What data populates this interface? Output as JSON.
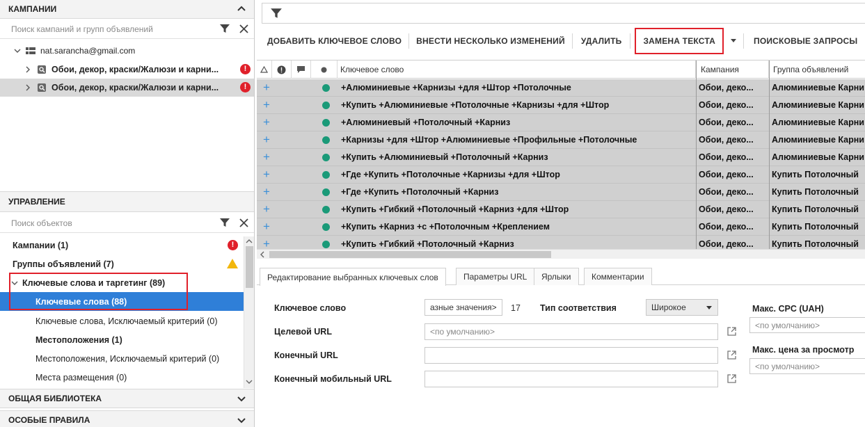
{
  "campaigns_panel": {
    "title": "КАМПАНИИ",
    "search_placeholder": "Поиск кампаний и групп объявлений",
    "account": "nat.sarancha@gmail.com",
    "items": [
      {
        "label": "Обои, декор, краски/Жалюзи и карни...",
        "badge": "!"
      },
      {
        "label": "Обои, декор, краски/Жалюзи и карни...",
        "badge": "!"
      }
    ]
  },
  "management_panel": {
    "title": "УПРАВЛЕНИЕ",
    "search_placeholder": "Поиск объектов",
    "items": [
      {
        "label": "Кампании (1)",
        "badge": "!"
      },
      {
        "label": "Группы объявлений (7)",
        "badge": "!"
      },
      {
        "label": "Ключевые слова и таргетинг (89)"
      },
      {
        "label": "Ключевые слова (88)"
      },
      {
        "label": "Ключевые слова, Исключаемый критерий (0)"
      },
      {
        "label": "Местоположения (1)"
      },
      {
        "label": "Местоположения, Исключаемый критерий (0)"
      },
      {
        "label": "Места размещения (0)"
      }
    ]
  },
  "library_panel": {
    "title": "ОБЩАЯ БИБЛИОТЕКА"
  },
  "rules_panel": {
    "title": "ОСОБЫЕ ПРАВИЛА"
  },
  "toolbar": {
    "add_keyword": "ДОБАВИТЬ КЛЮЧЕВОЕ СЛОВО",
    "multi_edit": "ВНЕСТИ НЕСКОЛЬКО ИЗМЕНЕНИЙ",
    "delete": "УДАЛИТЬ",
    "replace_text": "ЗАМЕНА ТЕКСТА",
    "search_queries": "ПОИСКОВЫЕ ЗАПРОСЫ"
  },
  "grid": {
    "columns": {
      "keyword": "Ключевое слово",
      "campaign": "Кампания",
      "ad_group": "Группа объявлений"
    },
    "rows": [
      {
        "keyword": "+Алюминиевые +Карнизы +для +Штор +Потолочные",
        "campaign": "Обои, деко...",
        "ad_group": "Алюминиевые Карни"
      },
      {
        "keyword": "+Купить +Алюминиевые +Потолочные +Карнизы +для +Штор",
        "campaign": "Обои, деко...",
        "ad_group": "Алюминиевые Карни"
      },
      {
        "keyword": "+Алюминиевый +Потолочный +Карниз",
        "campaign": "Обои, деко...",
        "ad_group": "Алюминиевые Карни"
      },
      {
        "keyword": "+Карнизы +для +Штор +Алюминиевые +Профильные +Потолочные",
        "campaign": "Обои, деко...",
        "ad_group": "Алюминиевые Карни"
      },
      {
        "keyword": "+Купить +Алюминиевый +Потолочный +Карниз",
        "campaign": "Обои, деко...",
        "ad_group": "Алюминиевые Карни"
      },
      {
        "keyword": "+Где +Купить +Потолочные +Карнизы +для +Штор",
        "campaign": "Обои, деко...",
        "ad_group": "Купить Потолочный"
      },
      {
        "keyword": "+Где +Купить +Потолочный +Карниз",
        "campaign": "Обои, деко...",
        "ad_group": "Купить Потолочный"
      },
      {
        "keyword": "+Купить +Гибкий +Потолочный +Карниз +для +Штор",
        "campaign": "Обои, деко...",
        "ad_group": "Купить Потолочный"
      },
      {
        "keyword": "+Купить +Карниз +с +Потолочным +Креплением",
        "campaign": "Обои, деко...",
        "ad_group": "Купить Потолочный"
      },
      {
        "keyword": "+Купить +Гибкий +Потолочный +Карниз",
        "campaign": "Обои, деко...",
        "ad_group": "Купить Потолочный"
      }
    ]
  },
  "tabs": [
    {
      "label": "Редактирование выбранных ключевых слов"
    },
    {
      "label": "Параметры URL"
    },
    {
      "label": "Ярлыки"
    },
    {
      "label": "Комментарии"
    }
  ],
  "form": {
    "keyword_label": "Ключевое слово",
    "keyword_value": "азные значения>",
    "keyword_count": "17",
    "match_type_label": "Тип соответствия",
    "match_type_value": "Широкое",
    "target_url_label": "Целевой URL",
    "target_url_placeholder": "<по умолчанию>",
    "final_url_label": "Конечный URL",
    "final_mobile_url_label": "Конечный мобильный URL",
    "max_cpc_label": "Макс. CPC (UAH)",
    "max_cpc_placeholder": "<по умолчанию>",
    "max_cpv_label": "Макс. цена за просмотр",
    "max_cpv_placeholder": "<по умолчанию>"
  },
  "colors": {
    "accent": "#2f7fd8",
    "highlight": "#e0202a",
    "row_bg": "#d0d0d0",
    "status_dot": "#1a9a78",
    "warning": "#f2b70c"
  }
}
